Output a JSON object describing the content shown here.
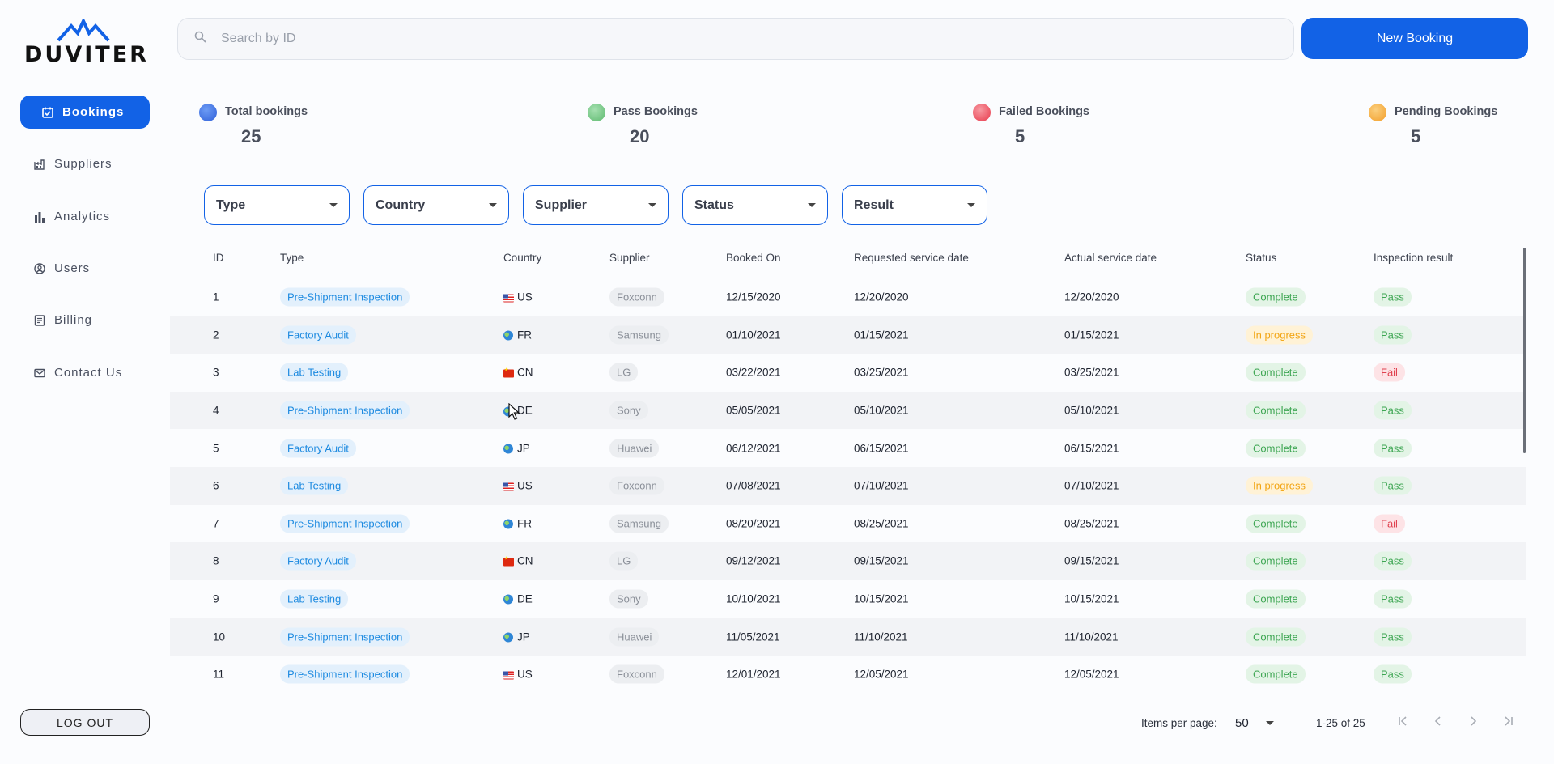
{
  "brand": {
    "name": "DUVITER"
  },
  "sidebar": {
    "items": [
      {
        "label": "Bookings",
        "icon": "calendar-check-icon",
        "active": true
      },
      {
        "label": "Suppliers",
        "icon": "factory-icon",
        "active": false
      },
      {
        "label": "Analytics",
        "icon": "bar-chart-icon",
        "active": false
      },
      {
        "label": "Users",
        "icon": "user-circle-icon",
        "active": false
      },
      {
        "label": "Billing",
        "icon": "receipt-icon",
        "active": false
      },
      {
        "label": "Contact Us",
        "icon": "mail-icon",
        "active": false
      }
    ],
    "logout_label": "LOG OUT"
  },
  "header": {
    "search_placeholder": "Search by ID",
    "new_booking_label": "New Booking"
  },
  "stats": [
    {
      "label": "Total bookings",
      "value": "25",
      "color": "#2f6fe8"
    },
    {
      "label": "Pass Bookings",
      "value": "20",
      "color": "#6cc47f"
    },
    {
      "label": "Failed Bookings",
      "value": "5",
      "color": "#ef4d5c"
    },
    {
      "label": "Pending Bookings",
      "value": "5",
      "color": "#f5a733"
    }
  ],
  "filters": [
    "Type",
    "Country",
    "Supplier",
    "Status",
    "Result"
  ],
  "table": {
    "columns": [
      "ID",
      "Type",
      "Country",
      "Supplier",
      "Booked On",
      "Requested service date",
      "Actual service date",
      "Status",
      "Inspection result"
    ],
    "rows": [
      {
        "id": "1",
        "type": "Pre-Shipment Inspection",
        "country": "US",
        "flag": "us",
        "supplier": "Foxconn",
        "booked": "12/15/2020",
        "requested": "12/20/2020",
        "actual": "12/20/2020",
        "status": "Complete",
        "result": "Pass"
      },
      {
        "id": "2",
        "type": "Factory Audit",
        "country": "FR",
        "flag": "globe",
        "supplier": "Samsung",
        "booked": "01/10/2021",
        "requested": "01/15/2021",
        "actual": "01/15/2021",
        "status": "In progress",
        "result": "Pass"
      },
      {
        "id": "3",
        "type": "Lab Testing",
        "country": "CN",
        "flag": "cn",
        "supplier": "LG",
        "booked": "03/22/2021",
        "requested": "03/25/2021",
        "actual": "03/25/2021",
        "status": "Complete",
        "result": "Fail"
      },
      {
        "id": "4",
        "type": "Pre-Shipment Inspection",
        "country": "DE",
        "flag": "globe",
        "supplier": "Sony",
        "booked": "05/05/2021",
        "requested": "05/10/2021",
        "actual": "05/10/2021",
        "status": "Complete",
        "result": "Pass"
      },
      {
        "id": "5",
        "type": "Factory Audit",
        "country": "JP",
        "flag": "globe",
        "supplier": "Huawei",
        "booked": "06/12/2021",
        "requested": "06/15/2021",
        "actual": "06/15/2021",
        "status": "Complete",
        "result": "Pass"
      },
      {
        "id": "6",
        "type": "Lab Testing",
        "country": "US",
        "flag": "us",
        "supplier": "Foxconn",
        "booked": "07/08/2021",
        "requested": "07/10/2021",
        "actual": "07/10/2021",
        "status": "In progress",
        "result": "Pass"
      },
      {
        "id": "7",
        "type": "Pre-Shipment Inspection",
        "country": "FR",
        "flag": "globe",
        "supplier": "Samsung",
        "booked": "08/20/2021",
        "requested": "08/25/2021",
        "actual": "08/25/2021",
        "status": "Complete",
        "result": "Fail"
      },
      {
        "id": "8",
        "type": "Factory Audit",
        "country": "CN",
        "flag": "cn",
        "supplier": "LG",
        "booked": "09/12/2021",
        "requested": "09/15/2021",
        "actual": "09/15/2021",
        "status": "Complete",
        "result": "Pass"
      },
      {
        "id": "9",
        "type": "Lab Testing",
        "country": "DE",
        "flag": "globe",
        "supplier": "Sony",
        "booked": "10/10/2021",
        "requested": "10/15/2021",
        "actual": "10/15/2021",
        "status": "Complete",
        "result": "Pass"
      },
      {
        "id": "10",
        "type": "Pre-Shipment Inspection",
        "country": "JP",
        "flag": "globe",
        "supplier": "Huawei",
        "booked": "11/05/2021",
        "requested": "11/10/2021",
        "actual": "11/10/2021",
        "status": "Complete",
        "result": "Pass"
      },
      {
        "id": "11",
        "type": "Pre-Shipment Inspection",
        "country": "US",
        "flag": "us",
        "supplier": "Foxconn",
        "booked": "12/01/2021",
        "requested": "12/05/2021",
        "actual": "12/05/2021",
        "status": "Complete",
        "result": "Pass"
      }
    ]
  },
  "pagination": {
    "items_per_page_label": "Items per page:",
    "items_per_page": "50",
    "range_label": "1-25 of 25"
  }
}
